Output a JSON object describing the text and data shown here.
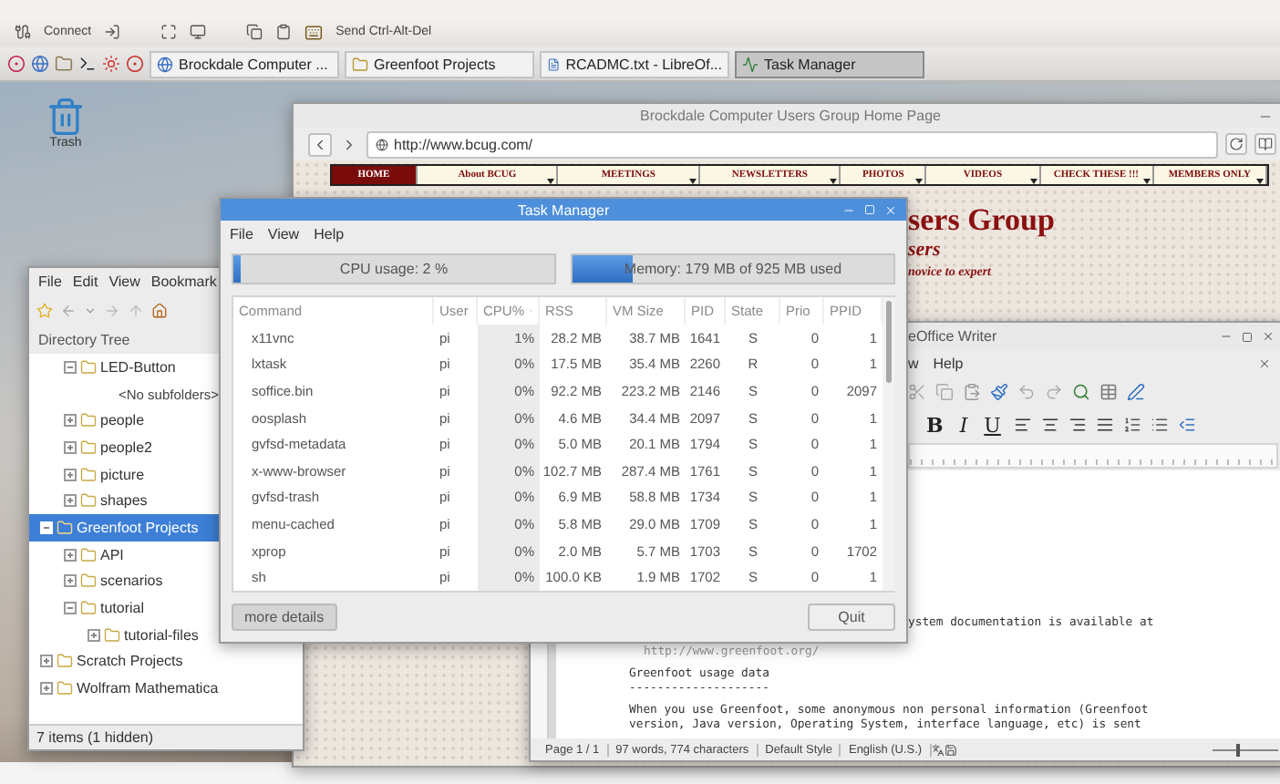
{
  "vnc_toolbar": {
    "connect": "Connect",
    "send_keys": "Send Ctrl-Alt-Del"
  },
  "taskbar": {
    "tasks": [
      {
        "label": "Brockdale Computer ...",
        "kind": "browser",
        "selected": false
      },
      {
        "label": "Greenfoot Projects",
        "kind": "folder",
        "selected": false
      },
      {
        "label": "RCADMC.txt - LibreOf...",
        "kind": "document",
        "selected": false
      },
      {
        "label": "Task Manager",
        "kind": "monitor",
        "selected": true
      }
    ]
  },
  "desktop_icons": [
    {
      "label": "Trash"
    }
  ],
  "browser": {
    "title": "Brockdale Computer Users Group Home Page",
    "url": "http://www.bcug.com/",
    "nav": [
      {
        "label": "HOME",
        "selected": true,
        "dropdown": false
      },
      {
        "label": "About BCUG",
        "selected": false,
        "dropdown": true
      },
      {
        "label": "MEETINGS",
        "selected": false,
        "dropdown": true
      },
      {
        "label": "NEWSLETTERS",
        "selected": false,
        "dropdown": true
      },
      {
        "label": "PHOTOS",
        "selected": false,
        "dropdown": true
      },
      {
        "label": "VIDEOS",
        "selected": false,
        "dropdown": true
      },
      {
        "label": "CHECK THESE !!!",
        "selected": false,
        "dropdown": true
      },
      {
        "label": "MEMBERS ONLY",
        "selected": false,
        "dropdown": true
      }
    ],
    "heading": "sers Group",
    "subheading": "sers",
    "tagline": "novice to expert"
  },
  "file_manager": {
    "menu": [
      "File",
      "Edit",
      "View",
      "Bookmark"
    ],
    "pane_title": "Directory Tree",
    "tree": [
      {
        "kind": "offscreen",
        "children": [
          {
            "label": "LED-Button",
            "kind": "folder",
            "expanded": true,
            "selected": false,
            "children": [
              {
                "label": "<No subfolders>",
                "kind": "note",
                "selected": false
              }
            ]
          },
          {
            "label": "people",
            "kind": "folder",
            "expanded": false,
            "selected": false
          },
          {
            "label": "people2",
            "kind": "folder",
            "expanded": false,
            "selected": false
          },
          {
            "label": "picture",
            "kind": "folder",
            "expanded": false,
            "selected": false
          },
          {
            "label": "shapes",
            "kind": "folder",
            "expanded": false,
            "selected": false
          }
        ]
      },
      {
        "label": "Greenfoot Projects",
        "kind": "folder",
        "expanded": true,
        "selected": true,
        "children": [
          {
            "label": "API",
            "kind": "folder",
            "expanded": false,
            "selected": false
          },
          {
            "label": "scenarios",
            "kind": "folder",
            "expanded": false,
            "selected": false
          },
          {
            "label": "tutorial",
            "kind": "folder",
            "expanded": true,
            "selected": false,
            "children": [
              {
                "label": "tutorial-files",
                "kind": "folder",
                "expanded": false,
                "selected": false
              }
            ]
          }
        ]
      },
      {
        "label": "Scratch Projects",
        "kind": "folder",
        "expanded": false,
        "selected": false
      },
      {
        "label": "Wolfram Mathematica",
        "kind": "folder",
        "expanded": false,
        "selected": false
      }
    ],
    "status": "7 items (1 hidden)"
  },
  "writer": {
    "title": "eOffice Writer",
    "menu": [
      "w",
      "Help"
    ],
    "format_buttons": [
      "B",
      "I",
      "U"
    ],
    "document_lines": [
      {
        "kind": "text",
        "text": "ystem documentation is available at"
      },
      {
        "kind": "url",
        "text": "http://www.greenfoot.org/"
      },
      {
        "kind": "heading",
        "text": "Greenfoot usage data"
      },
      {
        "kind": "rule",
        "text": "--------------------"
      },
      {
        "kind": "paragraph",
        "text": "When you use Greenfoot, some anonymous non personal information (Greenfoot"
      },
      {
        "kind": "text",
        "text": "version, Java version, Operating System, interface language, etc) is sent"
      }
    ],
    "status": [
      "Page 1 / 1",
      "97 words, 774 characters",
      "Default Style",
      "English (U.S.)"
    ],
    "zoom": {
      "level": 0.35
    }
  },
  "task_manager": {
    "title": "Task Manager",
    "menu": [
      "File",
      "View",
      "Help"
    ],
    "cpu": {
      "label": "CPU usage: 2 %",
      "level": 0.02
    },
    "memory": {
      "label": "Memory: 179 MB of 925 MB used",
      "level": 0.19
    },
    "columns": [
      {
        "label": "Command",
        "sorted": false
      },
      {
        "label": "User",
        "sorted": false
      },
      {
        "label": "CPU%",
        "sorted": true
      },
      {
        "label": "RSS",
        "sorted": false
      },
      {
        "label": "VM Size",
        "sorted": false
      },
      {
        "label": "PID",
        "sorted": false
      },
      {
        "label": "State",
        "sorted": false
      },
      {
        "label": "Prio",
        "sorted": false
      },
      {
        "label": "PPID",
        "sorted": false
      }
    ],
    "rows": [
      [
        "x11vnc",
        "pi",
        "1%",
        "28.2 MB",
        "38.7 MB",
        "1641",
        "S",
        "0",
        "1"
      ],
      [
        "lxtask",
        "pi",
        "0%",
        "17.5 MB",
        "35.4 MB",
        "2260",
        "R",
        "0",
        "1"
      ],
      [
        "soffice.bin",
        "pi",
        "0%",
        "92.2 MB",
        "223.2 MB",
        "2146",
        "S",
        "0",
        "2097"
      ],
      [
        "oosplash",
        "pi",
        "0%",
        "4.6 MB",
        "34.4 MB",
        "2097",
        "S",
        "0",
        "1"
      ],
      [
        "gvfsd-metadata",
        "pi",
        "0%",
        "5.0 MB",
        "20.1 MB",
        "1794",
        "S",
        "0",
        "1"
      ],
      [
        "x-www-browser",
        "pi",
        "0%",
        "102.7 MB",
        "287.4 MB",
        "1761",
        "S",
        "0",
        "1"
      ],
      [
        "gvfsd-trash",
        "pi",
        "0%",
        "6.9 MB",
        "58.8 MB",
        "1734",
        "S",
        "0",
        "1"
      ],
      [
        "menu-cached",
        "pi",
        "0%",
        "5.8 MB",
        "29.0 MB",
        "1709",
        "S",
        "0",
        "1"
      ],
      [
        "xprop",
        "pi",
        "0%",
        "2.0 MB",
        "5.7 MB",
        "1703",
        "S",
        "0",
        "1702"
      ],
      [
        "sh",
        "pi",
        "0%",
        "100.0 KB",
        "1.9 MB",
        "1702",
        "S",
        "0",
        "1"
      ]
    ],
    "buttons": {
      "details": "more details",
      "quit": "Quit"
    }
  }
}
